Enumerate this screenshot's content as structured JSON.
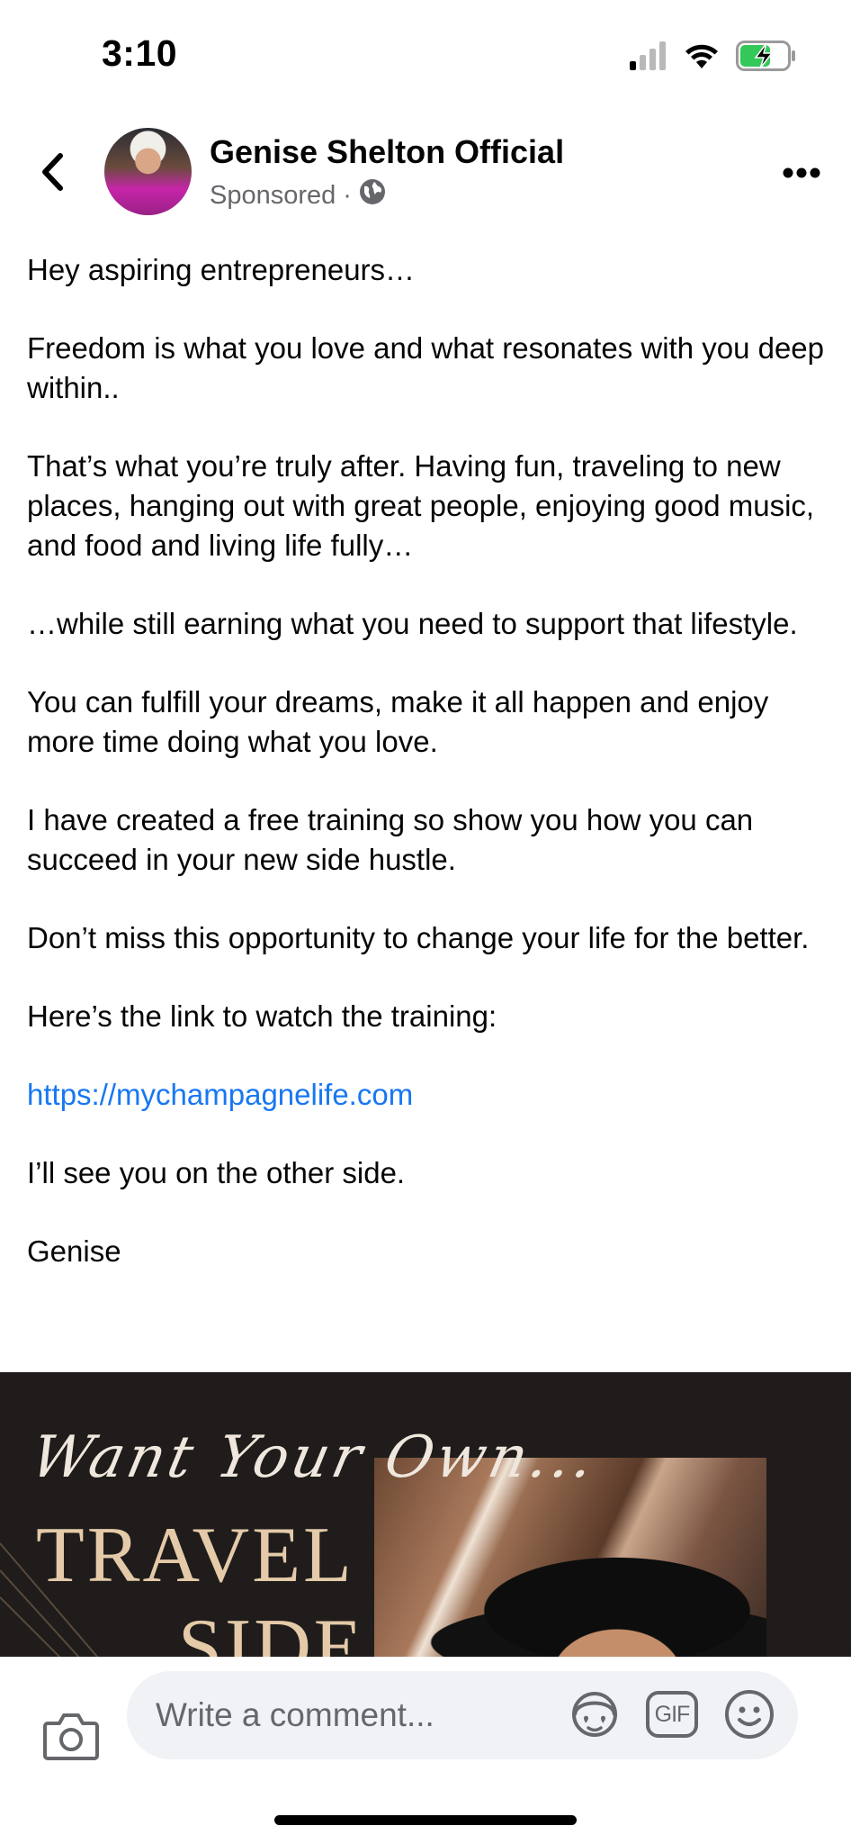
{
  "status_bar": {
    "time": "3:10",
    "icons": [
      "cellular-signal-icon",
      "wifi-icon",
      "battery-charging-icon"
    ]
  },
  "header": {
    "back_icon": "chevron-left-icon",
    "author": "Genise Shelton Official",
    "sponsored_label": "Sponsored",
    "separator": "·",
    "privacy_icon": "globe-icon",
    "more_icon": "more-horizontal-icon"
  },
  "post": {
    "paragraphs": [
      "Hey aspiring entrepreneurs…",
      "Freedom is what you love and what resonates with you deep within..",
      "That’s what you’re truly after.  Having fun, traveling to new places, hanging out with great people, enjoying good music, and food and living life fully…",
      "…while still earning what you need to support that lifestyle.",
      "You can fulfill your dreams, make it all happen and enjoy more time doing what you love.",
      "I have created a free training so show you how you can succeed in your new side hustle.",
      "Don’t miss this opportunity to change your life for the better.",
      "Here’s the link to watch the training:"
    ],
    "link": "https://mychampagnelife.com",
    "closing": "I’ll see you on the other side.",
    "signature": "Genise"
  },
  "ad_image": {
    "script_text": "Want Your Own...",
    "title_line1": "TRAVEL",
    "title_line2": "SIDE",
    "colors": {
      "background": "#1f1c1b",
      "title": "#e4caa8"
    }
  },
  "comment_bar": {
    "camera_icon": "camera-icon",
    "placeholder": "Write a comment...",
    "avatar_sticker_icon": "avatar-sticker-icon",
    "gif_label": "GIF",
    "emoji_icon": "emoji-icon"
  },
  "colors": {
    "link": "#1877f2",
    "secondary_text": "#65676b",
    "input_background": "#f0f2f5"
  }
}
